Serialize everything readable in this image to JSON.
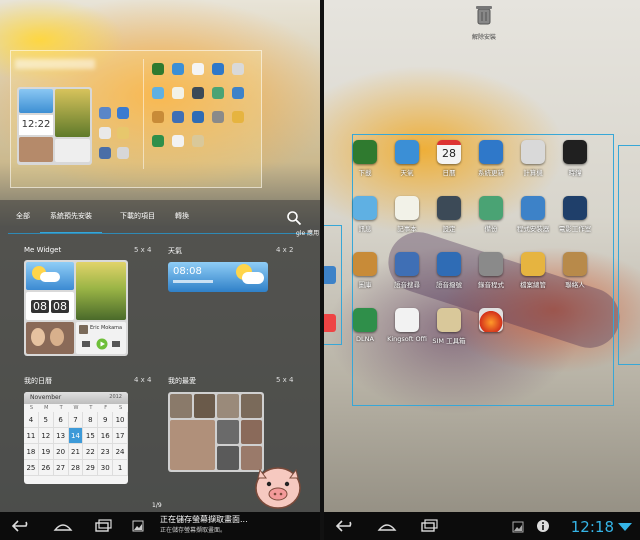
{
  "left": {
    "tabs": [
      "全部",
      "系統預先安裝",
      "下載的項目",
      "轉換"
    ],
    "widgets": [
      {
        "title": "Me Widget",
        "size": "5 x 4"
      },
      {
        "title": "天氣",
        "size": "4 x 2"
      },
      {
        "title": "我的日曆",
        "size": "4 x 4"
      },
      {
        "title": "我的最愛",
        "size": "5 x 4"
      }
    ],
    "me_widget": {
      "time_hour": "08",
      "time_min": "08",
      "contact_name": "Eric Mokama"
    },
    "weather_time": "08:08",
    "calendar": {
      "month": "November",
      "year": "2012",
      "weekdays": [
        "S",
        "M",
        "T",
        "W",
        "T",
        "F",
        "S"
      ],
      "rows": [
        [
          "4",
          "5",
          "6",
          "7",
          "8",
          "9",
          "10"
        ],
        [
          "11",
          "12",
          "13",
          "14",
          "15",
          "16",
          "17"
        ],
        [
          "18",
          "19",
          "20",
          "21",
          "22",
          "23",
          "24"
        ],
        [
          "25",
          "26",
          "27",
          "28",
          "29",
          "30",
          "1"
        ]
      ]
    },
    "page_indicator": "1/9",
    "preview_time": "12:22",
    "peek_label": "gle 應用",
    "toast": [
      "正在儲存螢幕擷取畫面...",
      "正在儲存螢幕擷取畫面。"
    ]
  },
  "right": {
    "trash_label": "解除安裝",
    "apps": [
      {
        "label": "下載",
        "color": "#2f7a2f"
      },
      {
        "label": "天氣",
        "color": "#3b8fd6"
      },
      {
        "label": "日曆",
        "color": "#f4f4f4",
        "text": "28"
      },
      {
        "label": "系統更新",
        "color": "#2f78c9"
      },
      {
        "label": "計算機",
        "color": "#d9d9d9"
      },
      {
        "label": "時鐘",
        "color": "#202020"
      },
      {
        "label": "訊息",
        "color": "#5fb0e3"
      },
      {
        "label": "記事本",
        "color": "#f2f2e8"
      },
      {
        "label": "設定",
        "color": "#3c4a57"
      },
      {
        "label": "備份",
        "color": "#4aa374"
      },
      {
        "label": "程式安裝器",
        "color": "#3d82c8"
      },
      {
        "label": "電影工作室",
        "color": "#1f3f6a"
      },
      {
        "label": "圖庫",
        "color": "#c88b38"
      },
      {
        "label": "語音搜尋",
        "color": "#3f6fb5"
      },
      {
        "label": "語音撥號",
        "color": "#2f6cb5"
      },
      {
        "label": "錄音程式",
        "color": "#8a8a8a"
      },
      {
        "label": "檔案總管",
        "color": "#e6b440"
      },
      {
        "label": "聯絡人",
        "color": "#b88a4a"
      },
      {
        "label": "DLNA",
        "color": "#2f8f4a"
      },
      {
        "label": "Kingsoft Offi",
        "color": "#f2f2f2"
      },
      {
        "label": "SIM 工具箱",
        "color": "#d9c89a"
      },
      {
        "label": "",
        "color": "#e0e0e0"
      }
    ],
    "time": "12:18"
  }
}
